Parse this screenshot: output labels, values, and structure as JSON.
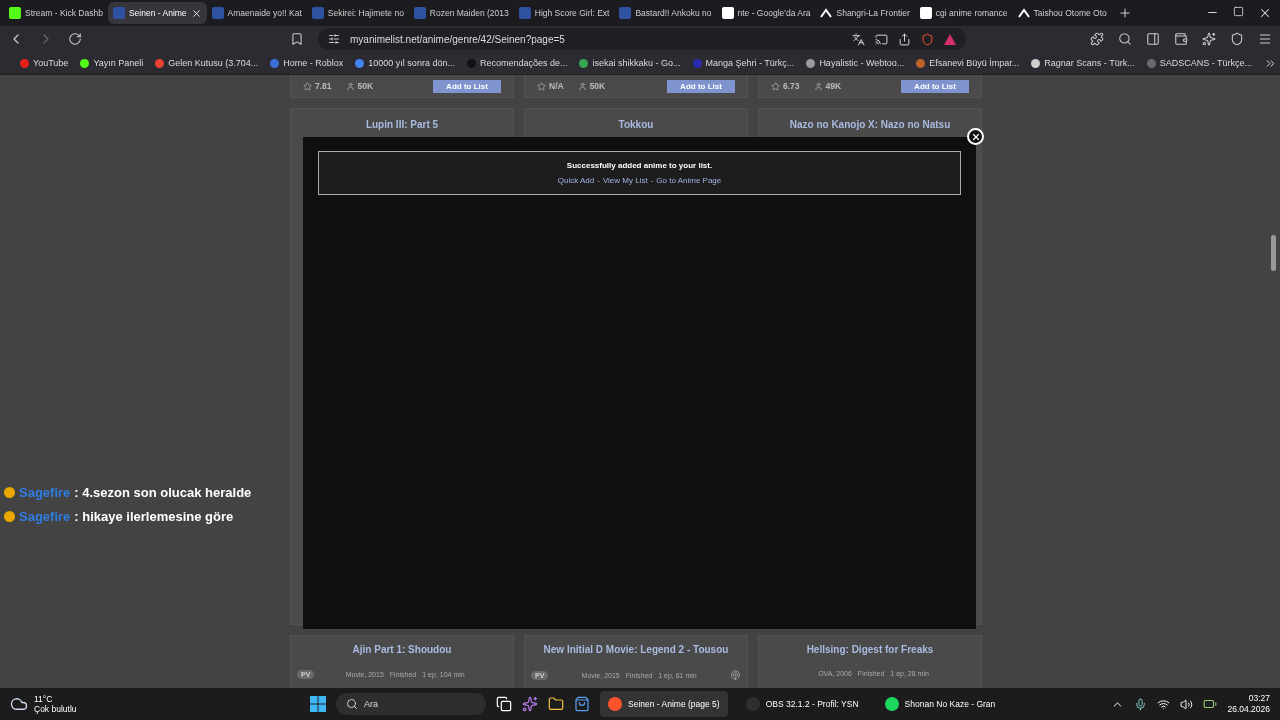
{
  "browser": {
    "tabs": [
      {
        "title": "Stream - Kick Dashb",
        "kind": "kick",
        "selected": false
      },
      {
        "title": "Seinen - Anime",
        "kind": "mal",
        "selected": true
      },
      {
        "title": "Amaenaide yo!! Kat",
        "kind": "mal",
        "selected": false
      },
      {
        "title": "Sekirei: Hajimete no",
        "kind": "mal",
        "selected": false
      },
      {
        "title": "Rozen Maiden (2013",
        "kind": "mal",
        "selected": false
      },
      {
        "title": "High Score Girl: Ext",
        "kind": "mal",
        "selected": false
      },
      {
        "title": "Bastard!! Ankoku no",
        "kind": "mal",
        "selected": false
      },
      {
        "title": "nte - Google'da Ara",
        "kind": "google",
        "selected": false
      },
      {
        "title": "Shangri-La Frontier",
        "kind": "peak",
        "selected": false
      },
      {
        "title": "cgi anime romance",
        "kind": "google",
        "selected": false
      },
      {
        "title": "Taishou Otome Oto",
        "kind": "peak",
        "selected": false
      }
    ],
    "url": "myanimelist.net/anime/genre/42/Seinen?page=5",
    "bookmarks": [
      {
        "label": "YouTube",
        "color": "#e62117"
      },
      {
        "label": "Yayın Paneli",
        "color": "#53fc18"
      },
      {
        "label": "Gelen Kutusu (3.704...",
        "color": "#ea4335"
      },
      {
        "label": "Home - Roblox",
        "color": "#3b6fd8"
      },
      {
        "label": "10000 yıl sonra dön...",
        "color": "#4285f4"
      },
      {
        "label": "Recomendações de...",
        "color": "#111111"
      },
      {
        "label": "isekai shikkaku - Go...",
        "color": "#34a853"
      },
      {
        "label": "Manga Şehri - Türkç...",
        "color": "#2b2bb0"
      },
      {
        "label": "Hayalistic - Webtoo...",
        "color": "#9a9a9a"
      },
      {
        "label": "Efsanevi Büyü İmpar...",
        "color": "#c0602a"
      },
      {
        "label": "Ragnar Scans - Türk...",
        "color": "#cfcfcf"
      },
      {
        "label": "SADSCANS - Türkçe...",
        "color": "#6a6a6a"
      }
    ]
  },
  "cards_top": [
    {
      "score": "7.81",
      "members": "50K",
      "button": "Add to List"
    },
    {
      "score": "N/A",
      "members": "50K",
      "button": "Add to List"
    },
    {
      "score": "6.73",
      "members": "49K",
      "button": "Add to List"
    }
  ],
  "cards_middle": [
    {
      "title": "Lupin III: Part 5"
    },
    {
      "title": "Tokkou"
    },
    {
      "title": "Nazo no Kanojo X: Nazo no Natsu"
    }
  ],
  "modal": {
    "message": "Successfully added anime to your list.",
    "separator": "-",
    "links": [
      "Quick Add",
      "View My List",
      "Go to Anime Page"
    ]
  },
  "cards_bottom": [
    {
      "title": "Ajin Part 1: Shoudou",
      "pv": "PV",
      "type": "Movie, 2015",
      "status": "Finished",
      "episodes": "1 ep, 104 min"
    },
    {
      "title": "New Initial D Movie: Legend 2 - Tousou",
      "pv": "PV",
      "type": "Movie, 2015",
      "status": "Finished",
      "episodes": "1 ep, 61 min"
    },
    {
      "title": "Hellsing: Digest for Freaks",
      "type": "OVA, 2006",
      "status": "Finished",
      "episodes": "1 ep, 28 min"
    }
  ],
  "chat": [
    {
      "user": "Sagefire",
      "message": ": 4.sezon son olucak heralde"
    },
    {
      "user": "Sagefire",
      "message": ": hikaye ilerlemesine göre"
    }
  ],
  "taskbar": {
    "temperature": "11°C",
    "weather": "Çok bulutlu",
    "search": "Ara",
    "apps": [
      {
        "kind": "brave",
        "label": "Seinen - Anime (page 5)",
        "selected": true
      },
      {
        "kind": "obs",
        "label": "OBS 32.1.2 - Profil: YSN",
        "selected": false
      },
      {
        "kind": "spotify",
        "label": "Shonan No Kaze - Gran",
        "selected": false
      }
    ],
    "time": "03:27",
    "date": "26.04.2026"
  }
}
